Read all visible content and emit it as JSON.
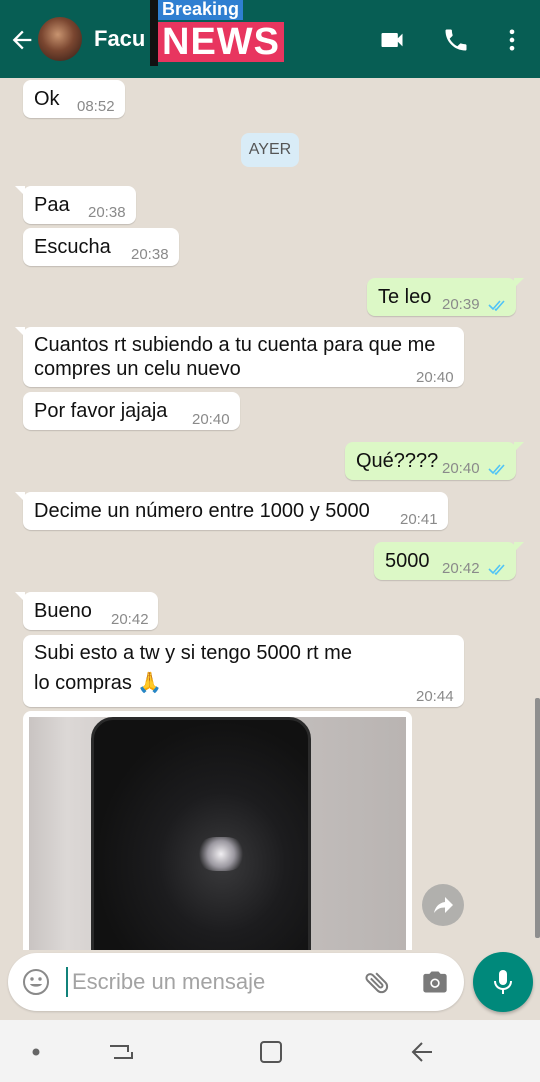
{
  "header": {
    "contact_name": "Facu",
    "badge_top": "Breaking",
    "badge_main": "NEWS",
    "color": "#075e54"
  },
  "chat": {
    "date_separator": "AYER",
    "messages": [
      {
        "text": "Ok",
        "time": "08:52",
        "dir": "in"
      },
      {
        "text": "Paa",
        "time": "20:38",
        "dir": "in"
      },
      {
        "text": "Escucha",
        "time": "20:38",
        "dir": "in"
      },
      {
        "text": "Te leo",
        "time": "20:39",
        "dir": "out",
        "status": "read"
      },
      {
        "text_line1": "Cuantos rt subiendo a tu cuenta para que me",
        "text_line2": "compres un celu nuevo",
        "time": "20:40",
        "dir": "in"
      },
      {
        "text": "Por favor jajaja",
        "time": "20:40",
        "dir": "in"
      },
      {
        "text": "Qué????",
        "time": "20:40",
        "dir": "out",
        "status": "read"
      },
      {
        "text": "Decime un número entre 1000 y 5000",
        "time": "20:41",
        "dir": "in"
      },
      {
        "text": "5000",
        "time": "20:42",
        "dir": "out",
        "status": "read"
      },
      {
        "text": "Bueno",
        "time": "20:42",
        "dir": "in"
      },
      {
        "text_line1": "Subi esto a tw y si tengo 5000 rt me",
        "text_line2": "lo compras 🙏",
        "time": "20:44",
        "dir": "in"
      }
    ],
    "photo": {
      "description_icon": "phone-photo"
    }
  },
  "composer": {
    "placeholder": "Escribe un mensaje",
    "value": ""
  },
  "icons": {
    "back": "arrow-left-icon",
    "video": "video-call-icon",
    "call": "phone-icon",
    "menu": "more-vert-icon",
    "emoji": "emoji-icon",
    "attach": "paperclip-icon",
    "camera": "camera-icon",
    "mic": "mic-icon",
    "share": "share-icon"
  },
  "colors": {
    "accent": "#00897b",
    "outgoing_bubble": "#dcf8c6",
    "read_tick": "#4fc3f7"
  }
}
